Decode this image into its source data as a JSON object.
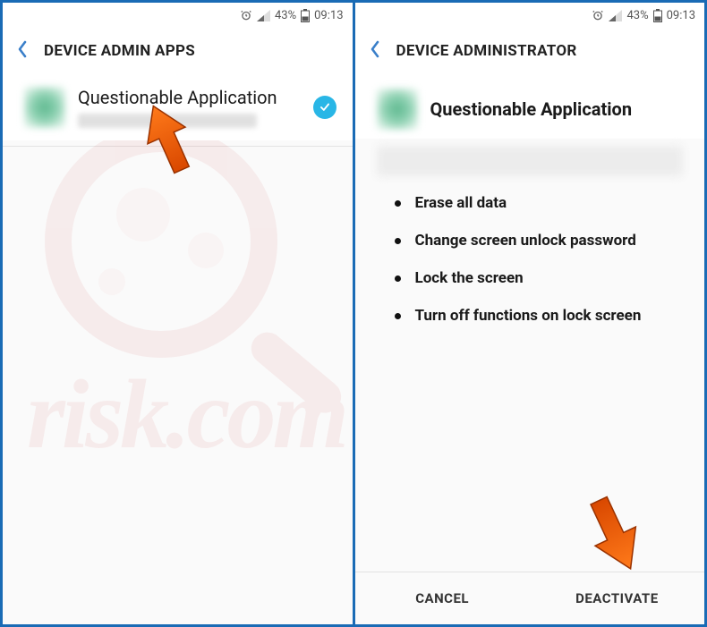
{
  "status": {
    "battery_pct": "43%",
    "time": "09:13"
  },
  "screen1": {
    "title": "DEVICE ADMIN APPS",
    "app_name": "Questionable Application"
  },
  "screen2": {
    "title": "DEVICE ADMINISTRATOR",
    "app_name": "Questionable Application",
    "permissions": [
      "Erase all data",
      "Change screen unlock password",
      "Lock the screen",
      "Turn off functions on lock screen"
    ],
    "cancel": "CANCEL",
    "deactivate": "DEACTIVATE"
  },
  "watermark": "risk.com"
}
